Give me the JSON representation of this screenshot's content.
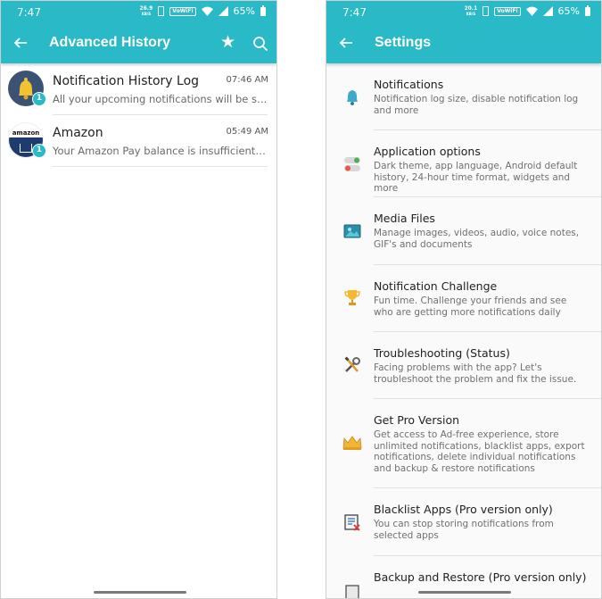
{
  "left_screen": {
    "status_bar": {
      "time": "7:47",
      "net_speed": "26.9",
      "net_unit": "KB/S",
      "wifi_label": "VoWiFi",
      "battery": "65%"
    },
    "app_bar": {
      "title": "Advanced History"
    },
    "items": [
      {
        "name": "Notification History Log",
        "time": "07:46 AM",
        "message": "All your upcoming notifications will be shown here",
        "badge": "1",
        "icon": "bell-icon"
      },
      {
        "name": "Amazon",
        "time": "05:49 AM",
        "message": "Your Amazon Pay balance is insufficient for your order",
        "badge": "1",
        "icon": "amazon-logo",
        "logo_text": "amazon"
      }
    ]
  },
  "right_screen": {
    "status_bar": {
      "time": "7:47",
      "net_speed": "20.1",
      "net_unit": "KB/S",
      "wifi_label": "VoWiFi",
      "battery": "65%"
    },
    "app_bar": {
      "title": "Settings"
    },
    "items": [
      {
        "title": "Notifications",
        "desc": "Notification log size, disable notification log and more",
        "icon": "bell-icon"
      },
      {
        "title": "Application options",
        "desc": "Dark theme, app language, Android default history, 24-hour time format, widgets and more",
        "icon": "toggle-icon"
      },
      {
        "title": "Media Files",
        "desc": "Manage images, videos, audio, voice notes, GIF's and documents",
        "icon": "image-icon"
      },
      {
        "title": "Notification Challenge",
        "desc": "Fun time. Challenge your friends and see who are getting more notifications daily",
        "icon": "trophy-icon"
      },
      {
        "title": "Troubleshooting (Status)",
        "desc": "Facing problems with the app? Let's troubleshoot the problem and fix the issue.",
        "icon": "tools-icon"
      },
      {
        "title": "Get Pro Version",
        "desc": "Get access to Ad-free experience, store unlimited notifications, blacklist apps, export notifications, delete individual notifications and backup & restore notifications",
        "icon": "crown-icon"
      },
      {
        "title": "Blacklist Apps (Pro version only)",
        "desc": "You can stop storing notifications from selected apps",
        "icon": "blacklist-icon"
      },
      {
        "title": "Backup and Restore (Pro version only)",
        "desc": "",
        "icon": "backup-icon"
      }
    ]
  },
  "colors": {
    "accent": "#29b9c7"
  }
}
